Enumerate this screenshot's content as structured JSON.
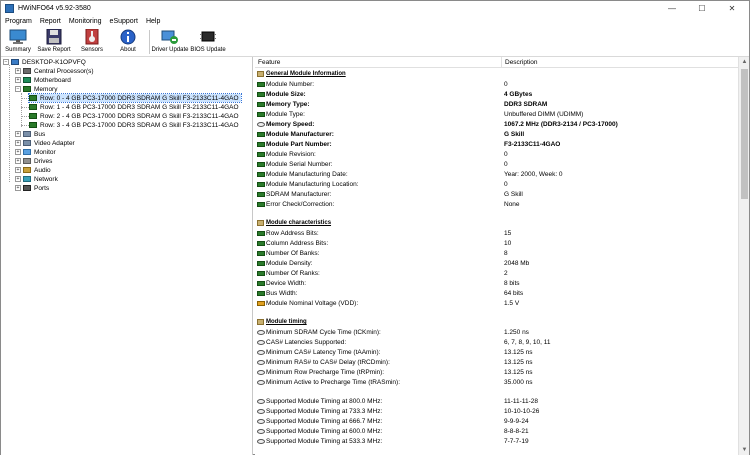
{
  "window": {
    "title": "HWiNFO64 v5.92-3580",
    "controls": [
      "—",
      "☐",
      "✕"
    ]
  },
  "menu": [
    "Program",
    "Report",
    "Monitoring",
    "eSupport",
    "Help"
  ],
  "toolbar": [
    {
      "label": "Summary",
      "icon": "monitor-icon"
    },
    {
      "label": "Save Report",
      "icon": "floppy-icon"
    },
    {
      "label": "Sensors",
      "icon": "sensors-icon"
    },
    {
      "label": "About",
      "icon": "info-icon"
    },
    {
      "label": "Driver Update",
      "icon": "driver-update-icon"
    },
    {
      "label": "BIOS Update",
      "icon": "bios-chip-icon"
    }
  ],
  "tree": {
    "root": "DESKTOP-K1OPVFQ",
    "items": [
      "Central Processor(s)",
      "Motherboard",
      "Memory",
      "Row: 0 - 4 GB PC3-17000 DDR3 SDRAM G Skill F3-2133C11-4GAO",
      "Row: 1 - 4 GB PC3-17000 DDR3 SDRAM G Skill F3-2133C11-4GAO",
      "Row: 2 - 4 GB PC3-17000 DDR3 SDRAM G Skill F3-2133C11-4GAO",
      "Row: 3 - 4 GB PC3-17000 DDR3 SDRAM G Skill F3-2133C11-4GAO",
      "Bus",
      "Video Adapter",
      "Monitor",
      "Drives",
      "Audio",
      "Network",
      "Ports"
    ],
    "toggles": {
      "collapsed": "+",
      "expanded": "−"
    }
  },
  "details": {
    "headers": {
      "feature": "Feature",
      "description": "Description"
    },
    "sections": [
      {
        "title": "General Module Information",
        "rows": [
          {
            "f": "Module Number:",
            "d": "0",
            "bold": false,
            "icon": "mem"
          },
          {
            "f": "Module Size:",
            "d": "4 GBytes",
            "bold": true,
            "icon": "mem"
          },
          {
            "f": "Memory Type:",
            "d": "DDR3 SDRAM",
            "bold": true,
            "icon": "mem"
          },
          {
            "f": "Module Type:",
            "d": "Unbuffered DIMM (UDIMM)",
            "bold": false,
            "icon": "mem"
          },
          {
            "f": "Memory Speed:",
            "d": "1067.2 MHz (DDR3-2134 / PC3-17000)",
            "bold": true,
            "icon": "clock"
          },
          {
            "f": "Module Manufacturer:",
            "d": "G Skill",
            "bold": true,
            "icon": "mem"
          },
          {
            "f": "Module Part Number:",
            "d": "F3-2133C11-4GAO",
            "bold": true,
            "icon": "mem"
          },
          {
            "f": "Module Revision:",
            "d": "0",
            "bold": false,
            "icon": "mem"
          },
          {
            "f": "Module Serial Number:",
            "d": "0",
            "bold": false,
            "icon": "mem"
          },
          {
            "f": "Module Manufacturing Date:",
            "d": "Year: 2000, Week: 0",
            "bold": false,
            "icon": "mem"
          },
          {
            "f": "Module Manufacturing Location:",
            "d": "0",
            "bold": false,
            "icon": "mem"
          },
          {
            "f": "SDRAM Manufacturer:",
            "d": "G Skill",
            "bold": false,
            "icon": "mem"
          },
          {
            "f": "Error Check/Correction:",
            "d": "None",
            "bold": false,
            "icon": "mem"
          }
        ]
      },
      {
        "title": "Module characteristics",
        "rows": [
          {
            "f": "Row Address Bits:",
            "d": "15",
            "bold": false,
            "icon": "mem"
          },
          {
            "f": "Column Address Bits:",
            "d": "10",
            "bold": false,
            "icon": "mem"
          },
          {
            "f": "Number Of Banks:",
            "d": "8",
            "bold": false,
            "icon": "mem"
          },
          {
            "f": "Module Density:",
            "d": "2048 Mb",
            "bold": false,
            "icon": "mem"
          },
          {
            "f": "Number Of Ranks:",
            "d": "2",
            "bold": false,
            "icon": "mem"
          },
          {
            "f": "Device Width:",
            "d": "8 bits",
            "bold": false,
            "icon": "mem"
          },
          {
            "f": "Bus Width:",
            "d": "64 bits",
            "bold": false,
            "icon": "mem"
          },
          {
            "f": "Module Nominal Voltage (VDD):",
            "d": "1.5 V",
            "bold": false,
            "icon": "volt"
          }
        ]
      },
      {
        "title": "Module timing",
        "rows": [
          {
            "f": "Minimum SDRAM Cycle Time (tCKmin):",
            "d": "1.250 ns",
            "bold": false,
            "icon": "clock"
          },
          {
            "f": "CAS# Latencies Supported:",
            "d": "6, 7, 8, 9, 10, 11",
            "bold": false,
            "icon": "clock"
          },
          {
            "f": "Minimum CAS# Latency Time (tAAmin):",
            "d": "13.125 ns",
            "bold": false,
            "icon": "clock"
          },
          {
            "f": "Minimum RAS# to CAS# Delay (tRCDmin):",
            "d": "13.125 ns",
            "bold": false,
            "icon": "clock"
          },
          {
            "f": "Minimum Row Precharge Time (tRPmin):",
            "d": "13.125 ns",
            "bold": false,
            "icon": "clock"
          },
          {
            "f": "Minimum Active to Precharge Time (tRASmin):",
            "d": "35.000 ns",
            "bold": false,
            "icon": "clock"
          }
        ]
      },
      {
        "title": "",
        "rows": [
          {
            "f": "Supported Module Timing at 800.0 MHz:",
            "d": "11-11-11-28",
            "bold": false,
            "icon": "clock"
          },
          {
            "f": "Supported Module Timing at 733.3 MHz:",
            "d": "10-10-10-26",
            "bold": false,
            "icon": "clock"
          },
          {
            "f": "Supported Module Timing at 666.7 MHz:",
            "d": "9-9-9-24",
            "bold": false,
            "icon": "clock"
          },
          {
            "f": "Supported Module Timing at 600.0 MHz:",
            "d": "8-8-8-21",
            "bold": false,
            "icon": "clock"
          },
          {
            "f": "Supported Module Timing at 533.3 MHz:",
            "d": "7-7-7-19",
            "bold": false,
            "icon": "clock"
          }
        ]
      }
    ]
  },
  "scrollbar": {
    "up": "▲",
    "down": "▼"
  }
}
